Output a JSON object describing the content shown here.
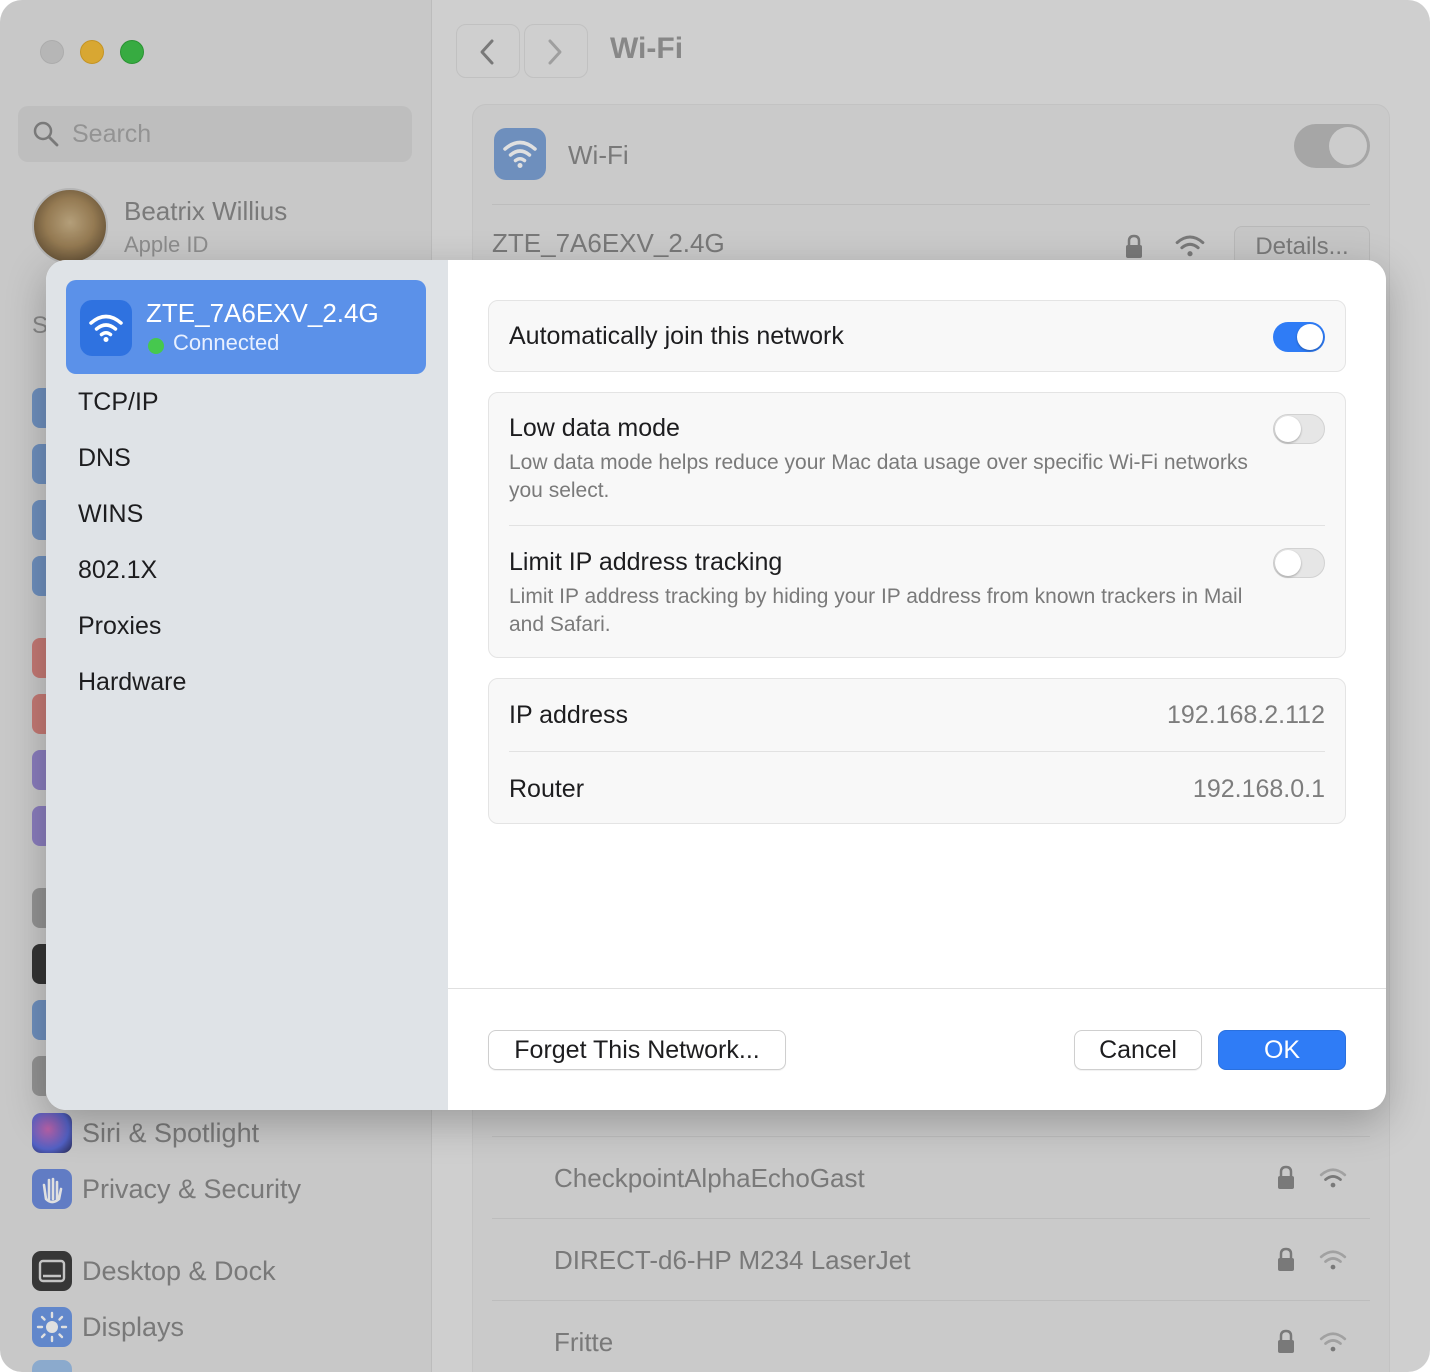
{
  "window": {
    "title": "Wi-Fi",
    "search": {
      "placeholder": "Search"
    },
    "profile": {
      "name": "Beatrix Willius",
      "subtitle": "Apple ID"
    },
    "section_letter": "S",
    "sidebar_items": [
      {
        "label": "Siri & Spotlight",
        "icon": "siri-icon",
        "color": "#8e6fd0"
      },
      {
        "label": "Privacy & Security",
        "icon": "hand-icon",
        "color": "#5e7fd6"
      },
      {
        "label": "Desktop & Dock",
        "icon": "dock-icon",
        "color": "#3a3a3a"
      },
      {
        "label": "Displays",
        "icon": "sun-icon",
        "color": "#4a8ef0"
      }
    ],
    "wifi_section": {
      "label": "Wi-Fi",
      "enabled": true,
      "current_network": "ZTE_7A6EXV_2.4G",
      "details_label": "Details..."
    },
    "other_networks": [
      {
        "name": "CheckpointAlphaEchoGast",
        "secured": true
      },
      {
        "name": "DIRECT-d6-HP M234 LaserJet",
        "secured": true
      },
      {
        "name": "Fritte",
        "secured": true
      }
    ]
  },
  "sheet": {
    "network": {
      "name": "ZTE_7A6EXV_2.4G",
      "status": "Connected",
      "status_color": "#46c84e"
    },
    "sidebar_links": [
      "TCP/IP",
      "DNS",
      "WINS",
      "802.1X",
      "Proxies",
      "Hardware"
    ],
    "auto_join": {
      "label": "Automatically join this network",
      "enabled": true
    },
    "low_data_mode": {
      "label": "Low data mode",
      "description": "Low data mode helps reduce your Mac data usage over specific Wi-Fi networks you select.",
      "enabled": false
    },
    "limit_ip_tracking": {
      "label": "Limit IP address tracking",
      "description": "Limit IP address tracking by hiding your IP address from known trackers in Mail and Safari.",
      "enabled": false
    },
    "ip_address": {
      "label": "IP address",
      "value": "192.168.2.112"
    },
    "router": {
      "label": "Router",
      "value": "192.168.0.1"
    },
    "buttons": {
      "forget": "Forget This Network...",
      "cancel": "Cancel",
      "ok": "OK"
    },
    "accent_color": "#2f7cf6"
  }
}
